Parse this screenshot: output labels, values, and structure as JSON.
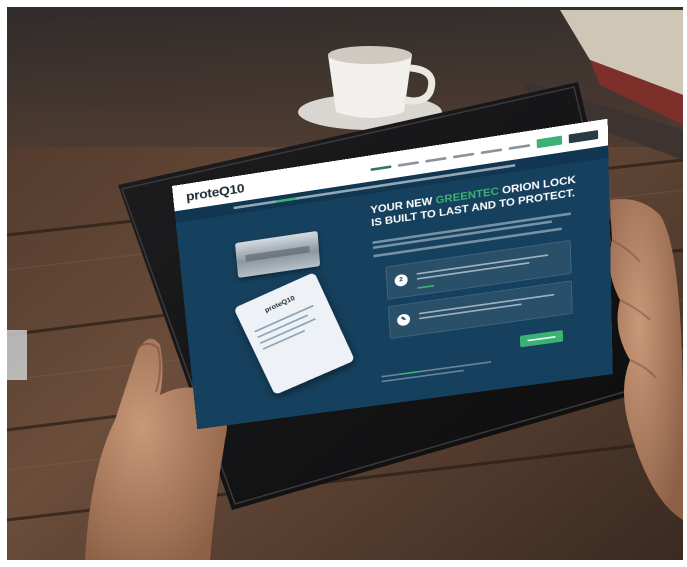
{
  "site": {
    "logo_text": "proteQ10",
    "nav_links": [
      "",
      "",
      "",
      "",
      "",
      ""
    ],
    "cta": "",
    "banner_text": ""
  },
  "hero": {
    "headline_pre": "YOUR NEW",
    "headline_highlight": "GREENTEC",
    "headline_post": "ORION LOCK IS BUILT TO LAST AND TO PROTECT."
  },
  "product_card": {
    "logo_text": "proteQ10"
  },
  "steps": [
    {
      "badge": "2",
      "icon": "step-icon"
    },
    {
      "badge": "✎",
      "icon": "pencil-icon"
    }
  ],
  "colors": {
    "accent_green": "#3bb273",
    "page_navy": "#16415e",
    "banner_navy": "#113651",
    "nav_white": "#ffffff"
  }
}
